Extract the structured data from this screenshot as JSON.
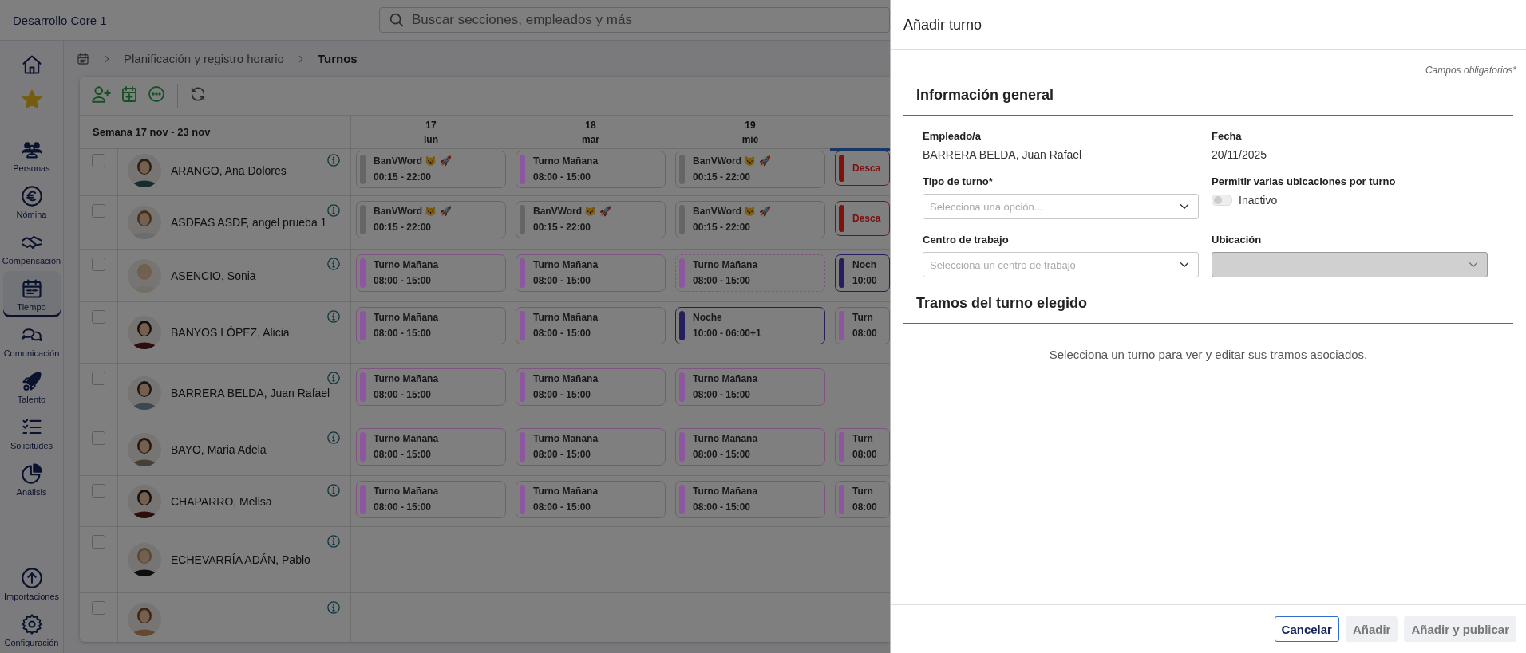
{
  "app": {
    "title": "Desarrollo Core 1",
    "search": {
      "placeholder": "Buscar secciones, empleados y más"
    }
  },
  "sidebar": {
    "items": [
      {
        "selected": false
      },
      {
        "selected": false
      },
      {
        "label": "Personas",
        "selected": false
      },
      {
        "label": "Nómina",
        "selected": false
      },
      {
        "label": "Compensación",
        "selected": false
      },
      {
        "label": "Tiempo",
        "selected": true
      },
      {
        "label": "Comunicación",
        "selected": false
      },
      {
        "label": "Talento",
        "selected": false
      },
      {
        "label": "Solicitudes",
        "selected": false
      },
      {
        "label": "Análisis",
        "selected": false
      }
    ],
    "bottom_items": [
      {
        "label": "Importaciones",
        "selected": false
      },
      {
        "label": "Configuración",
        "selected": false
      }
    ]
  },
  "breadcrumb": [
    "Planificación y registro horario",
    "Turnos"
  ],
  "schedule": {
    "week_label": "Semana 17 nov - 23 nov",
    "columns": [
      {
        "day": "17",
        "weekday": "lun",
        "today": false
      },
      {
        "day": "18",
        "weekday": "mar",
        "today": false
      },
      {
        "day": "19",
        "weekday": "mié",
        "today": false
      },
      {
        "today": true
      }
    ],
    "rows": [
      {
        "name": "ARANGO, Ana Dolores",
        "checked": false,
        "shifts": [
          {
            "title": "BanVWord 😾 🚀",
            "time": "00:15 - 22:00",
            "color": "#666666",
            "dashed": false
          },
          {
            "title": "Turno Mañana",
            "time": "08:00 - 15:00",
            "color": "#8e55a0",
            "dashed": false
          },
          {
            "title": "BanVWord 😾 🚀",
            "time": "00:15 - 22:00",
            "color": "#666666",
            "dashed": false
          },
          {
            "title": "Desca",
            "color": "#7d1010",
            "dashed": false
          }
        ]
      },
      {
        "name": "ASDFAS ASDF, angel prueba 1",
        "checked": false,
        "shifts": [
          {
            "title": "BanVWord 😾 🚀",
            "time": "00:15 - 22:00",
            "color": "#666666",
            "dashed": false
          },
          {
            "title": "BanVWord 😾 🚀",
            "time": "00:15 - 22:00",
            "color": "#666666",
            "dashed": false
          },
          {
            "title": "BanVWord 😾 🚀",
            "time": "00:15 - 22:00",
            "color": "#666666",
            "dashed": false
          },
          {
            "title": "Desca",
            "color": "#7d1010",
            "dashed": false
          }
        ]
      },
      {
        "name": "ASENCIO, Sonia",
        "checked": false,
        "shifts": [
          {
            "title": "Turno Mañana",
            "time": "08:00 - 15:00",
            "color": "#8e55a0",
            "dashed": false
          },
          {
            "title": "Turno Mañana",
            "time": "08:00 - 15:00",
            "color": "#8e55a0",
            "dashed": false
          },
          {
            "title": "Turno Mañana",
            "time": "08:00 - 15:00",
            "color": "#8e55a0",
            "dashed": true
          },
          {
            "title": "Noch",
            "time": "10:00",
            "color": "#241d5e",
            "dashed": false
          }
        ]
      },
      {
        "name": "BANYOS LÓPEZ, Alicia",
        "checked": false,
        "shifts": [
          {
            "title": "Turno Mañana",
            "time": "08:00 - 15:00",
            "color": "#8e55a0",
            "dashed": false
          },
          {
            "title": "Turno Mañana",
            "time": "08:00 - 15:00",
            "color": "#8e55a0",
            "dashed": false
          },
          {
            "title": "Noche",
            "time": "10:00 - 06:00+1",
            "color": "#241d5e",
            "dashed": false
          },
          {
            "title": "Turn",
            "time": "08:00",
            "color": "#8e55a0",
            "dashed": false
          }
        ]
      },
      {
        "name": "BARRERA BELDA, Juan Rafael",
        "checked": false,
        "shifts": [
          {
            "title": "Turno Mañana",
            "time": "08:00 - 15:00",
            "color": "#8e55a0",
            "dashed": false
          },
          {
            "title": "Turno Mañana",
            "time": "08:00 - 15:00",
            "color": "#8e55a0",
            "dashed": false
          },
          {
            "title": "Turno Mañana",
            "time": "08:00 - 15:00",
            "color": "#8e55a0",
            "dashed": false
          }
        ]
      },
      {
        "name": "BAYO, Maria Adela",
        "checked": false,
        "shifts": [
          {
            "title": "Turno Mañana",
            "time": "08:00 - 15:00",
            "color": "#8e55a0",
            "dashed": false
          },
          {
            "title": "Turno Mañana",
            "time": "08:00 - 15:00",
            "color": "#8e55a0",
            "dashed": false
          },
          {
            "title": "Turno Mañana",
            "time": "08:00 - 15:00",
            "color": "#8e55a0",
            "dashed": false
          },
          {
            "title": "Turn",
            "time": "08:00",
            "color": "#8e55a0",
            "dashed": false
          }
        ]
      },
      {
        "name": "CHAPARRO, Melisa",
        "checked": false,
        "shifts": [
          {
            "title": "Turno Mañana",
            "time": "08:00 - 15:00",
            "color": "#8e55a0",
            "dashed": false
          },
          {
            "title": "Turno Mañana",
            "time": "08:00 - 15:00",
            "color": "#8e55a0",
            "dashed": false
          },
          {
            "title": "Turno Mañana",
            "time": "08:00 - 15:00",
            "color": "#8e55a0",
            "dashed": false
          },
          {
            "title": "Turn",
            "time": "08:00",
            "color": "#8e55a0",
            "dashed": false
          }
        ]
      },
      {
        "name": "ECHEVARRÍA ADÁN, Pablo",
        "checked": false
      },
      {
        "checked": false
      }
    ]
  },
  "panel": {
    "title": "Añadir turno",
    "required_note": "Campos obligatorios*",
    "general": {
      "title": "Información general",
      "employee": {
        "label": "Empleado/a",
        "value": "BARRERA BELDA, Juan Rafael"
      },
      "date": {
        "label": "Fecha",
        "value": "20/11/2025"
      },
      "shift_type": {
        "label": "Tipo de turno*",
        "placeholder": "Selecciona una opción...",
        "disabled": false
      },
      "multi_location": {
        "label": "Permitir varias ubicaciones por turno",
        "on": false,
        "state_text": "Inactivo"
      },
      "work_center": {
        "label": "Centro de trabajo",
        "placeholder": "Selecciona un centro de trabajo",
        "disabled": false
      },
      "location": {
        "label": "Ubicación",
        "disabled": true
      }
    },
    "segments": {
      "title": "Tramos del turno elegido",
      "empty_text": "Selecciona un turno para ver y editar sus tramos asociados."
    },
    "buttons": [
      {
        "label": "Cancelar",
        "disabled": false
      },
      {
        "label": "Añadir",
        "disabled": true
      },
      {
        "label": "Añadir y publicar",
        "disabled": true
      }
    ]
  }
}
